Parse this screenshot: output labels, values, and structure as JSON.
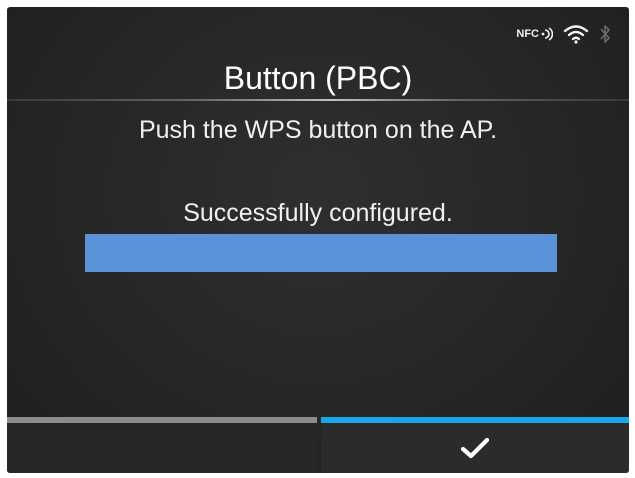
{
  "status_bar": {
    "nfc_label": "NFC",
    "icons": [
      "nfc-icon",
      "wifi-icon",
      "bluetooth-icon"
    ]
  },
  "header": {
    "title": "Button (PBC)"
  },
  "main": {
    "instruction": "Push the WPS button on the AP.",
    "status_message": "Successfully configured.",
    "progress_percent": 100,
    "progress_color": "#5b93d8"
  },
  "footer": {
    "left_softkey": {
      "label": "",
      "accent": "#8c8c8c"
    },
    "right_softkey": {
      "icon": "checkmark-icon",
      "accent": "#1aa7e8"
    }
  },
  "colors": {
    "background": "#262626",
    "text": "#ffffff"
  }
}
